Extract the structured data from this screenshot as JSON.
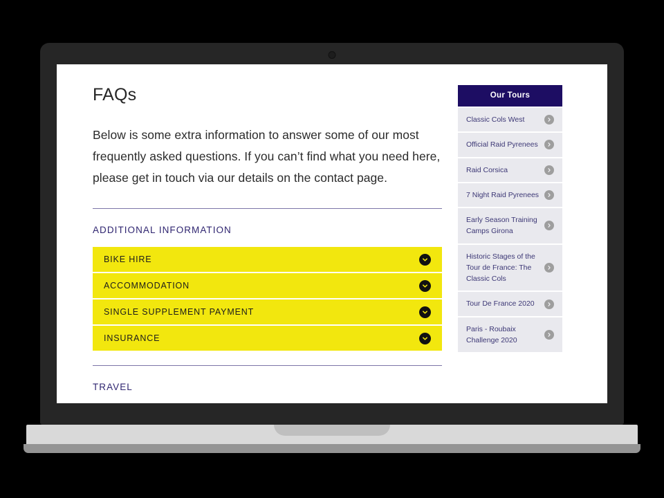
{
  "device": {
    "type": "laptop-mockup",
    "webcam_icon": "camera-dot-icon"
  },
  "page": {
    "title": "FAQs",
    "intro": "Below is some extra information to answer some of our most frequently asked questions. If you can’t find what you need here, please get in touch via our details on the contact page.",
    "sections": [
      {
        "heading": "ADDITIONAL INFORMATION",
        "items": [
          {
            "label": "BIKE HIRE",
            "icon": "chevron-down-circle-icon",
            "expanded": false
          },
          {
            "label": "ACCOMMODATION",
            "icon": "chevron-down-circle-icon",
            "expanded": false
          },
          {
            "label": "SINGLE SUPPLEMENT PAYMENT",
            "icon": "chevron-down-circle-icon",
            "expanded": false
          },
          {
            "label": "INSURANCE",
            "icon": "chevron-down-circle-icon",
            "expanded": false
          }
        ]
      },
      {
        "heading": "TRAVEL",
        "items": []
      }
    ]
  },
  "sidebar": {
    "header": "Our Tours",
    "items": [
      {
        "label": "Classic Cols West",
        "icon": "chevron-right-circle-icon"
      },
      {
        "label": "Official Raid Pyrenees",
        "icon": "chevron-right-circle-icon"
      },
      {
        "label": "Raid Corsica",
        "icon": "chevron-right-circle-icon"
      },
      {
        "label": "7 Night Raid Pyrenees",
        "icon": "chevron-right-circle-icon"
      },
      {
        "label": "Early Season Training Camps Girona",
        "icon": "chevron-right-circle-icon"
      },
      {
        "label": "Historic Stages of the Tour de France: The Classic Cols",
        "icon": "chevron-right-circle-icon"
      },
      {
        "label": "Tour De France 2020",
        "icon": "chevron-right-circle-icon"
      },
      {
        "label": "Paris - Roubaix Challenge 2020",
        "icon": "chevron-right-circle-icon"
      }
    ]
  },
  "colors": {
    "accent_yellow": "#F2E70E",
    "navy": "#1D0D63",
    "heading_indigo": "#2F2570",
    "rule_lavender": "#7B74A8",
    "sidebar_item_bg": "#E9E9EE",
    "sidebar_text": "#3C3775",
    "icon_gray": "#9E9E9E",
    "body_text": "#2B2B2B",
    "bezel": "#262626",
    "base": "#D9D9D9",
    "base_lip": "#949494",
    "backdrop": "#000000"
  }
}
